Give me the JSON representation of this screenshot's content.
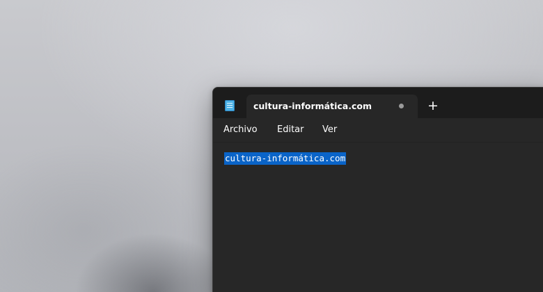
{
  "app": {
    "name": "Notepad",
    "icon": "notepad-icon"
  },
  "tab": {
    "title": "cultura-informática.com",
    "unsaved_indicator": "unsaved-dot-icon"
  },
  "new_tab": {
    "label": "+"
  },
  "menu": {
    "items": [
      {
        "label": "Archivo"
      },
      {
        "label": "Editar"
      },
      {
        "label": "Ver"
      }
    ]
  },
  "editor": {
    "content": "cultura-informática.com",
    "selected": true
  },
  "colors": {
    "selection": "#0a64c8",
    "window_bg": "#272727",
    "titlebar_bg": "#1c1c1c"
  }
}
